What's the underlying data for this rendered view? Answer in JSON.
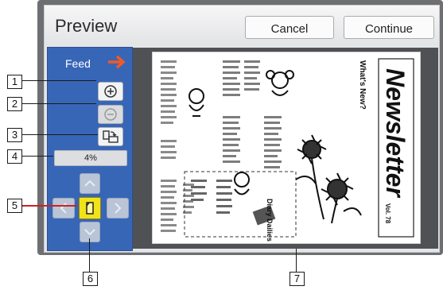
{
  "dialog": {
    "title": "Preview",
    "cancel_label": "Cancel",
    "continue_label": "Continue"
  },
  "panel": {
    "feed_label": "Feed",
    "zoom_value": "4%"
  },
  "document": {
    "newsletter_title": "Newsletter",
    "issue": "Vol. 78",
    "headline": "What's New?",
    "side_headline": "Diary Dailies"
  },
  "callouts": [
    "1",
    "2",
    "3",
    "4",
    "5",
    "6",
    "7"
  ],
  "colors": {
    "panel_blue": "#3866b7",
    "feed_arrow": "#f05a28",
    "highlight_yellow": "#f1e318",
    "callout_red": "#cc2222"
  }
}
